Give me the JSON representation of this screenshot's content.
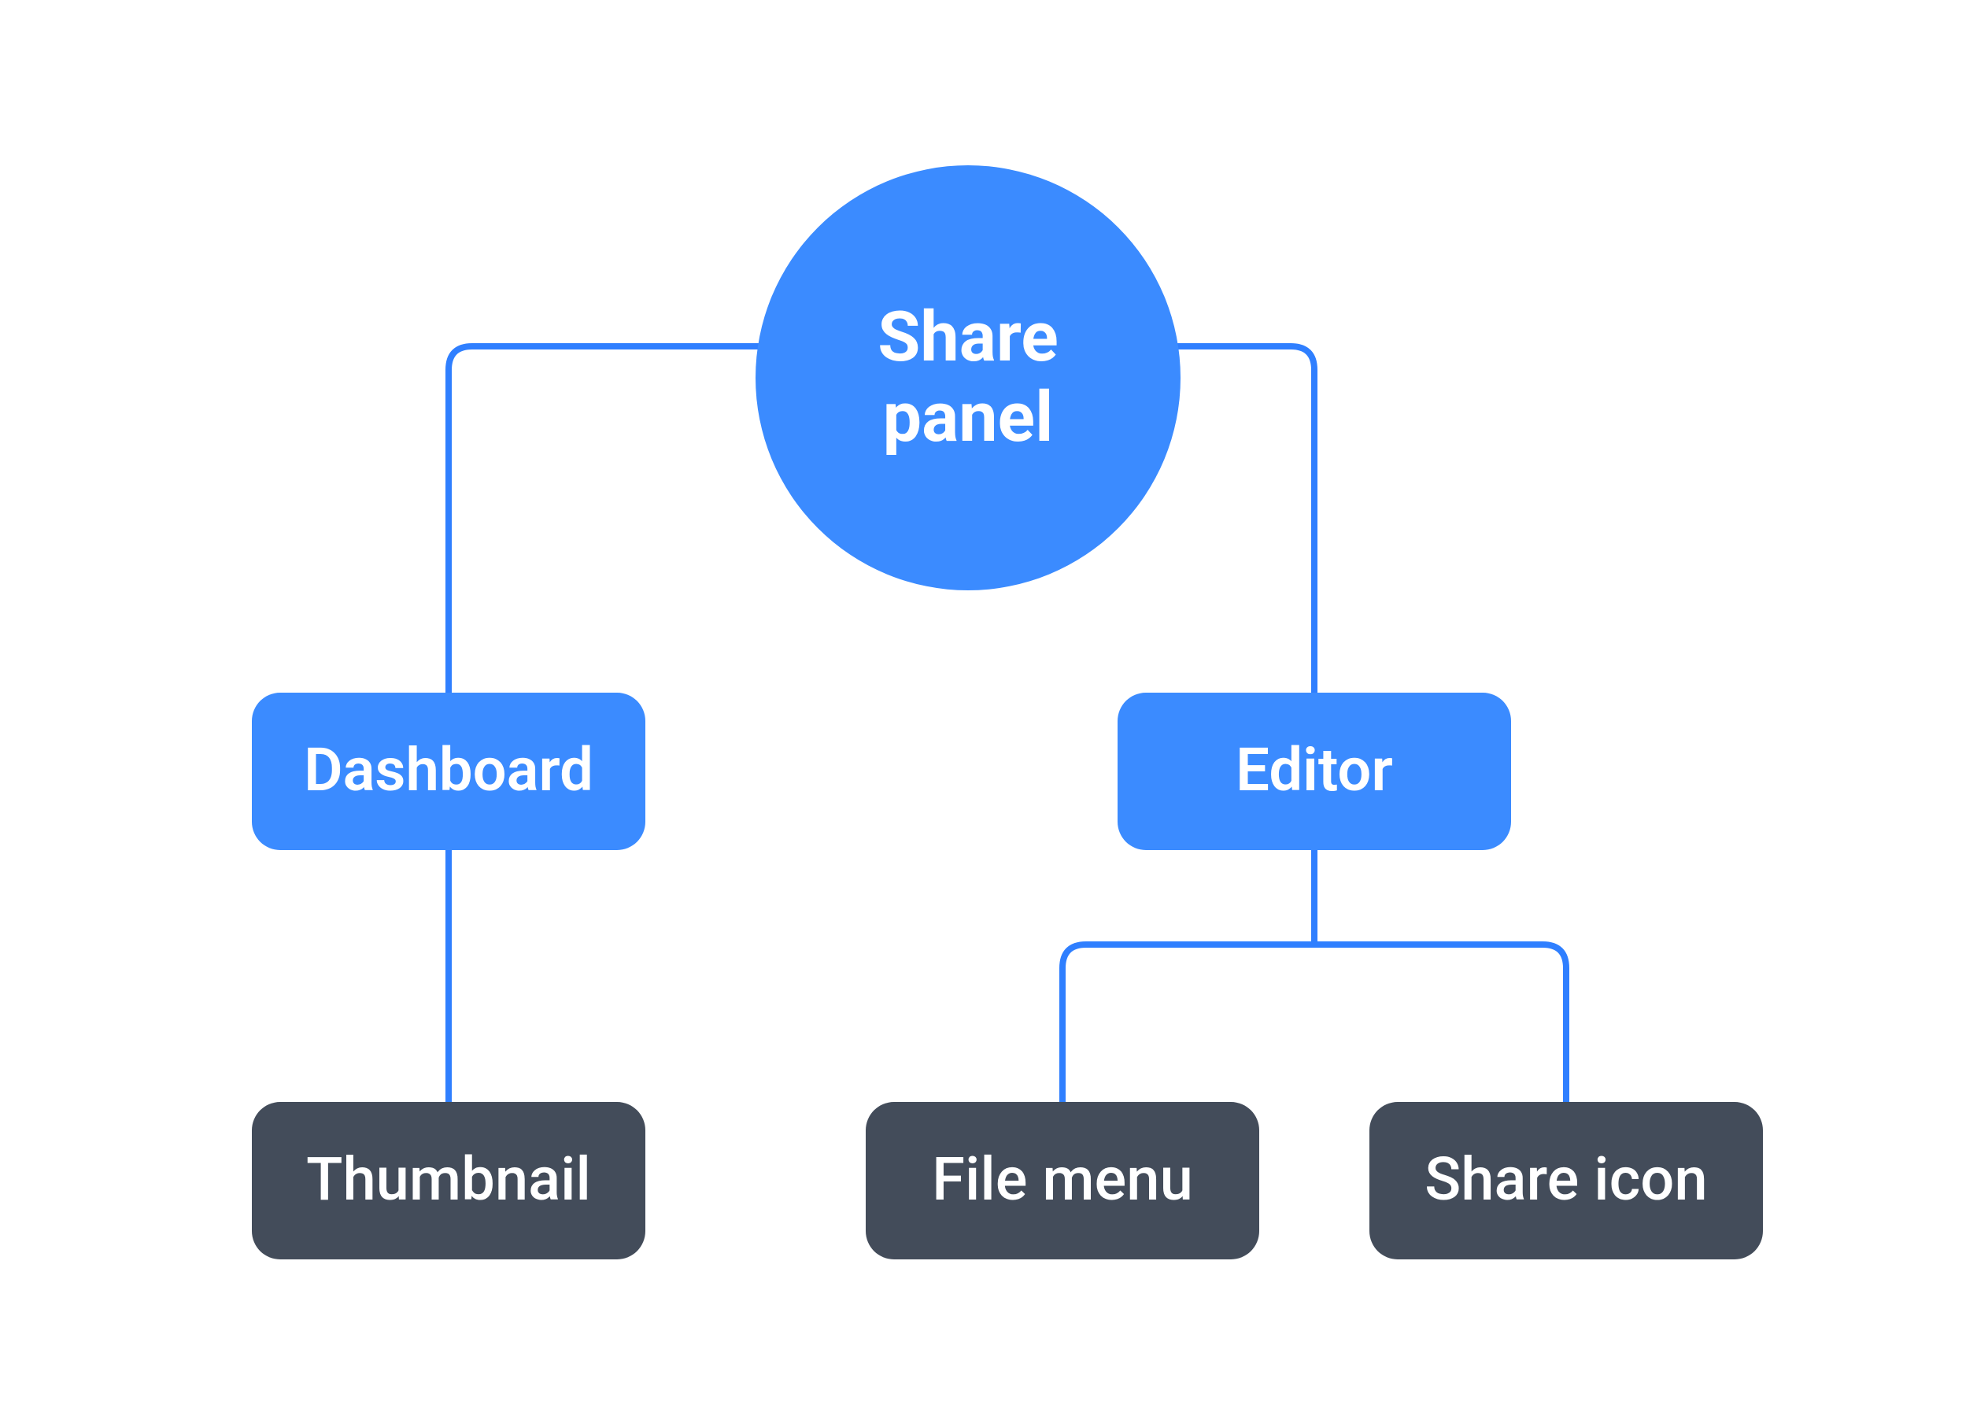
{
  "colors": {
    "primary": "#3b8bff",
    "secondary": "#434c5a",
    "line": "#2f7fff",
    "text": "#ffffff"
  },
  "root": {
    "label_line1": "Share",
    "label_line2": "panel"
  },
  "level1": {
    "left": {
      "label": "Dashboard"
    },
    "right": {
      "label": "Editor"
    }
  },
  "level2": {
    "thumbnail": {
      "label": "Thumbnail"
    },
    "file_menu": {
      "label": "File menu"
    },
    "share_icon": {
      "label": "Share icon"
    }
  }
}
